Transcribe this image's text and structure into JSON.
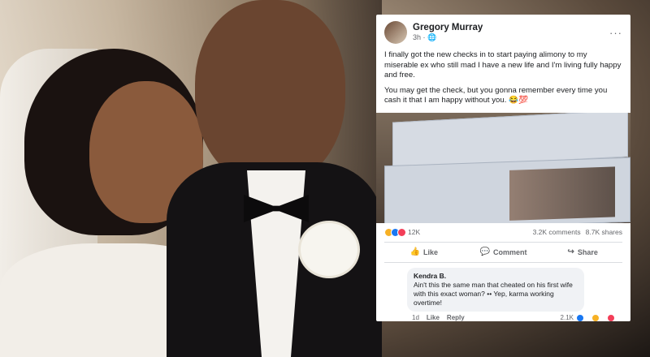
{
  "post": {
    "author": "Gregory Murray",
    "time": "3h · ",
    "menu_icon": "···",
    "text_1": "I finally got the new checks in to start paying alimony to my miserable ex who still mad I have a new life and I'm living fully happy and free.",
    "text_2": "You may get the check, but you gonna remember every time you cash it that I am happy without you. 😂💯"
  },
  "counts": {
    "reactions": "12K",
    "comments": "3.2K comments",
    "shares": "8.7K shares"
  },
  "actions": {
    "like": "Like",
    "comment": "Comment",
    "share": "Share"
  },
  "comment": {
    "author": "Kendra B.",
    "text": "Ain't this the same man that cheated on his first wife with this exact woman? •• Yep, karma working overtime!",
    "time": "1d",
    "like": "Like",
    "reply": "Reply",
    "reactions": "2.1K"
  },
  "colors": {
    "like_blue": "#1877f2",
    "haha_yellow": "#f7b125",
    "love_red": "#f33e58"
  }
}
